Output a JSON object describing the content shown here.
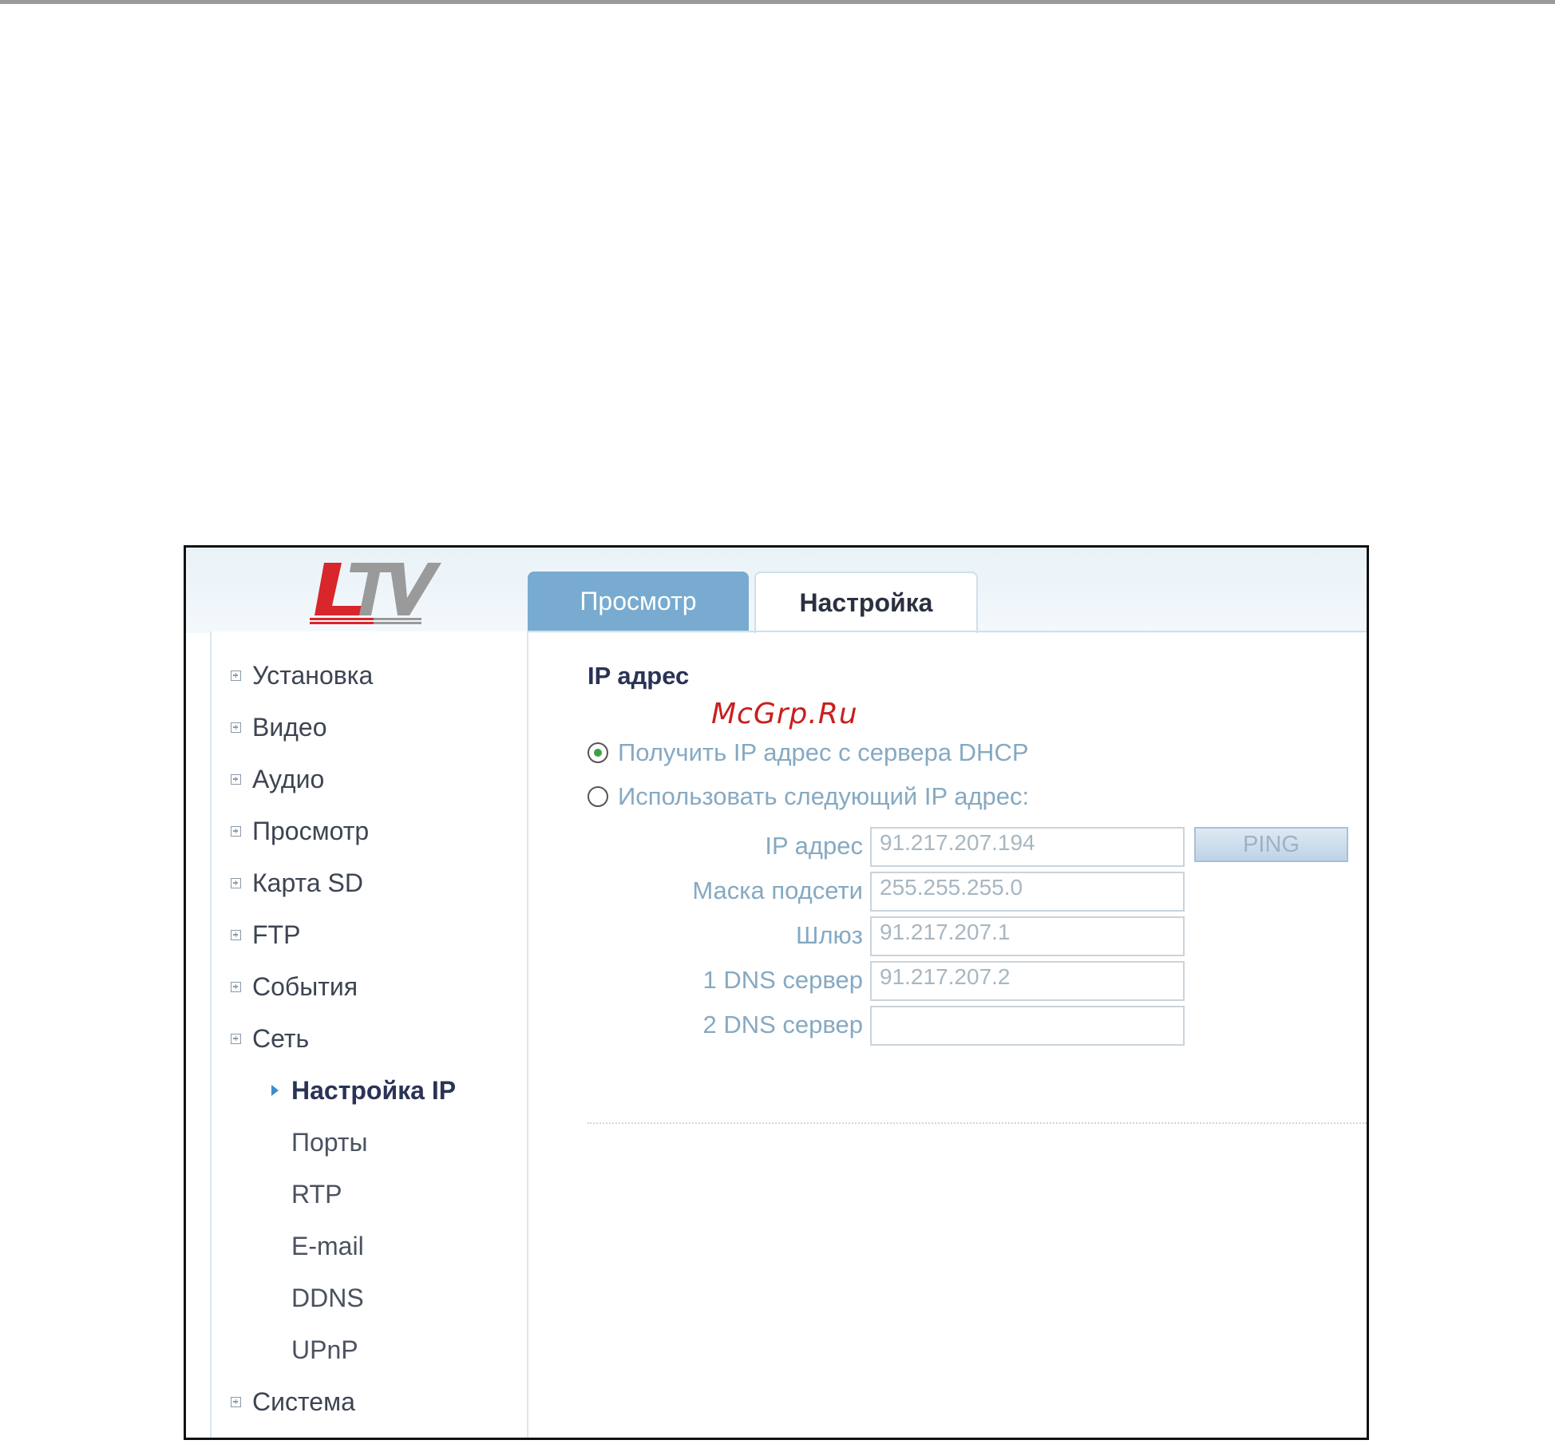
{
  "brand": {
    "logo_text": "LTV"
  },
  "tabs": [
    {
      "label": "Просмотр",
      "active": false
    },
    {
      "label": "Настройка",
      "active": true
    }
  ],
  "sidebar": {
    "items": [
      {
        "label": "Установка"
      },
      {
        "label": "Видео"
      },
      {
        "label": "Аудио"
      },
      {
        "label": "Просмотр"
      },
      {
        "label": "Карта SD"
      },
      {
        "label": "FTP"
      },
      {
        "label": "События"
      },
      {
        "label": "Сеть"
      },
      {
        "label": "Система"
      }
    ],
    "subitems": [
      {
        "label": "Настройка IP",
        "active": true
      },
      {
        "label": "Порты"
      },
      {
        "label": "RTP"
      },
      {
        "label": "E-mail"
      },
      {
        "label": "DDNS"
      },
      {
        "label": "UPnP"
      }
    ]
  },
  "main": {
    "section_title": "IP адрес",
    "watermark": "McGrp.Ru",
    "radio_dhcp": {
      "label": "Получить IP адрес с сервера DHCP",
      "checked": true
    },
    "radio_static": {
      "label": "Использовать следующий IP адрес:",
      "checked": false
    },
    "fields": [
      {
        "label": "IP адрес",
        "value": "91.217.207.194"
      },
      {
        "label": "Маска подсети",
        "value": "255.255.255.0"
      },
      {
        "label": "Шлюз",
        "value": "91.217.207.1"
      },
      {
        "label": "1 DNS сервер",
        "value": "91.217.207.2"
      },
      {
        "label": "2 DNS сервер",
        "value": ""
      }
    ],
    "ping_label": "PING"
  },
  "colors": {
    "accent_tab": "#78abcf",
    "radio_selected": "#3fa048",
    "watermark": "#c82020",
    "label_text": "#86a9c2"
  }
}
